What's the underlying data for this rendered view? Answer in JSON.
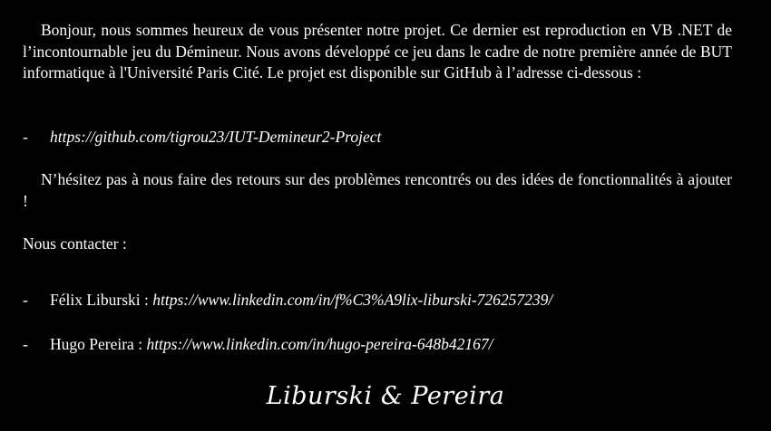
{
  "intro": {
    "text": "Bonjour, nous sommes heureux de vous présenter notre projet. Ce dernier est reproduction en VB .NET de l’incontournable jeu du Démineur. Nous avons développé ce jeu dans le cadre de notre première année de BUT informatique à l'Université Paris Cité. Le projet est disponible sur GitHub à l’adresse ci-dessous :"
  },
  "repo": {
    "dash": "-",
    "url": "https://github.com/tigrou23/IUT-Demineur2-Project"
  },
  "feedback": {
    "text": "N’hésitez pas à nous faire des retours sur des problèmes rencontrés ou des idées de fonctionnalités à ajouter !"
  },
  "contact": {
    "heading": "Nous contacter :",
    "people": [
      {
        "dash": "-",
        "name": "Félix Liburski : ",
        "url": "https://www.linkedin.com/in/f%C3%A9lix-liburski-726257239/"
      },
      {
        "dash": "-",
        "name": "Hugo Pereira : ",
        "url": "https://www.linkedin.com/in/hugo-pereira-648b42167/"
      }
    ]
  },
  "signature": "Liburski & Pereira"
}
